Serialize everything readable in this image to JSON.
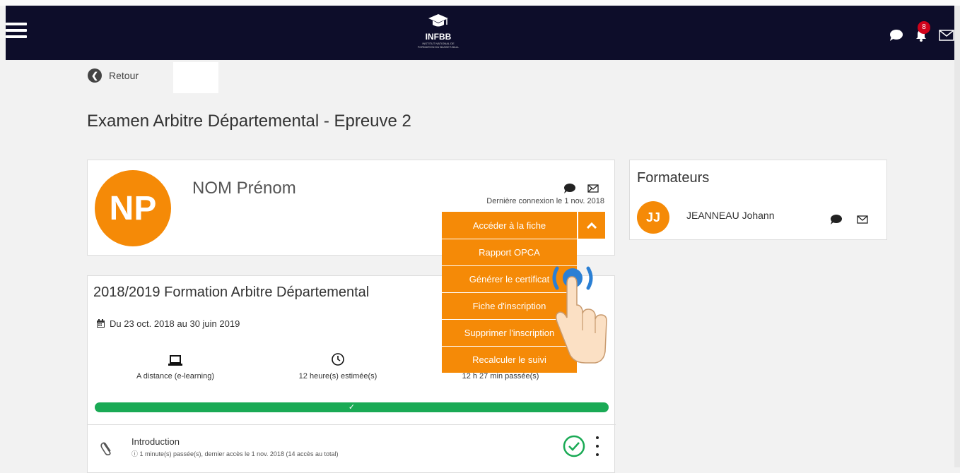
{
  "navbar": {
    "logo_text": "INFBB",
    "logo_subtext": "INSTITUT NATIONAL DE FORMATION DU BASKET-BALL",
    "notification_count": "8",
    "icons": [
      "menu-icon",
      "chat-icon",
      "bell-icon",
      "mail-icon"
    ]
  },
  "back": {
    "label": "Retour"
  },
  "page": {
    "title": "Examen Arbitre Départemental - Epreuve 2"
  },
  "student": {
    "initials": "NP",
    "name": "NOM Prénom",
    "last_login": "Dernière connexion le 1 nov. 2018"
  },
  "dropdown": {
    "main_label": "Accéder à la fiche",
    "items": [
      "Rapport OPCA",
      "Générer le certificat",
      "Fiche d'inscription",
      "Supprimer l'inscription",
      "Recalculer le suivi"
    ]
  },
  "formation": {
    "title": "2018/2019 Formation Arbitre Départemental",
    "dates": "Du 23 oct. 2018 au 30 juin 2019",
    "stats": [
      {
        "icon": "laptop-icon",
        "label": "A distance (e-learning)"
      },
      {
        "icon": "clock-icon",
        "label": "12 heure(s) estimée(s)"
      },
      {
        "icon": "hourglass-icon",
        "label": "12 h 27 min passée(s)"
      }
    ],
    "progress": 1.0,
    "progress_label": "✓"
  },
  "module": {
    "name": "Introduction",
    "info": "1 minute(s) passée(s), dernier accès le 1 nov. 2018 (14 accès au total)"
  },
  "trainers": {
    "title": "Formateurs",
    "items": [
      {
        "initials": "JJ",
        "name": "JEANNEAU Johann"
      }
    ]
  },
  "colors": {
    "navbar": "#0d0d2a",
    "accent": "#f58a07",
    "progress": "#1aaa55"
  }
}
